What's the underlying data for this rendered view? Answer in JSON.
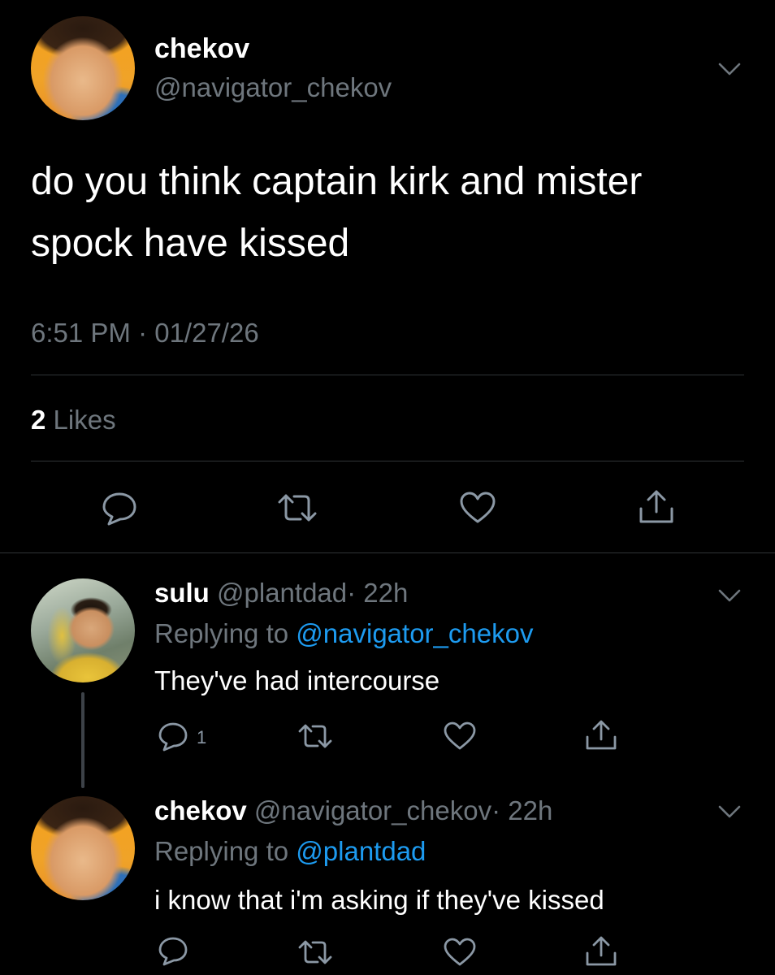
{
  "main_tweet": {
    "display_name": "chekov",
    "handle": "@navigator_chekov",
    "text_line1": "do you think captain kirk and mister",
    "text_line2": "spock have kissed",
    "timestamp": "6:51 PM · 01/27/26",
    "likes_count": "2",
    "likes_label": "Likes"
  },
  "replies": [
    {
      "display_name": "sulu",
      "handle": "@plantdad",
      "time": "· 22h",
      "replying_prefix": "Replying to",
      "replying_to": "@navigator_chekov",
      "text": "They've had intercourse",
      "reply_count": "1"
    },
    {
      "display_name": "chekov",
      "handle": "@navigator_chekov",
      "time": "· 22h",
      "replying_prefix": "Replying to",
      "replying_to": "@plantdad",
      "text": "i know that i'm asking if they've kissed",
      "reply_count": ""
    }
  ],
  "icons": {
    "reply": "speech-bubble-icon",
    "retweet": "retweet-arrows-icon",
    "like": "heart-icon",
    "share": "share-upload-icon",
    "menu": "chevron-down-icon"
  },
  "colors": {
    "background": "#000000",
    "text": "#ffffff",
    "muted": "#6e767d",
    "link": "#1d9bf0",
    "divider": "#2f3336"
  }
}
